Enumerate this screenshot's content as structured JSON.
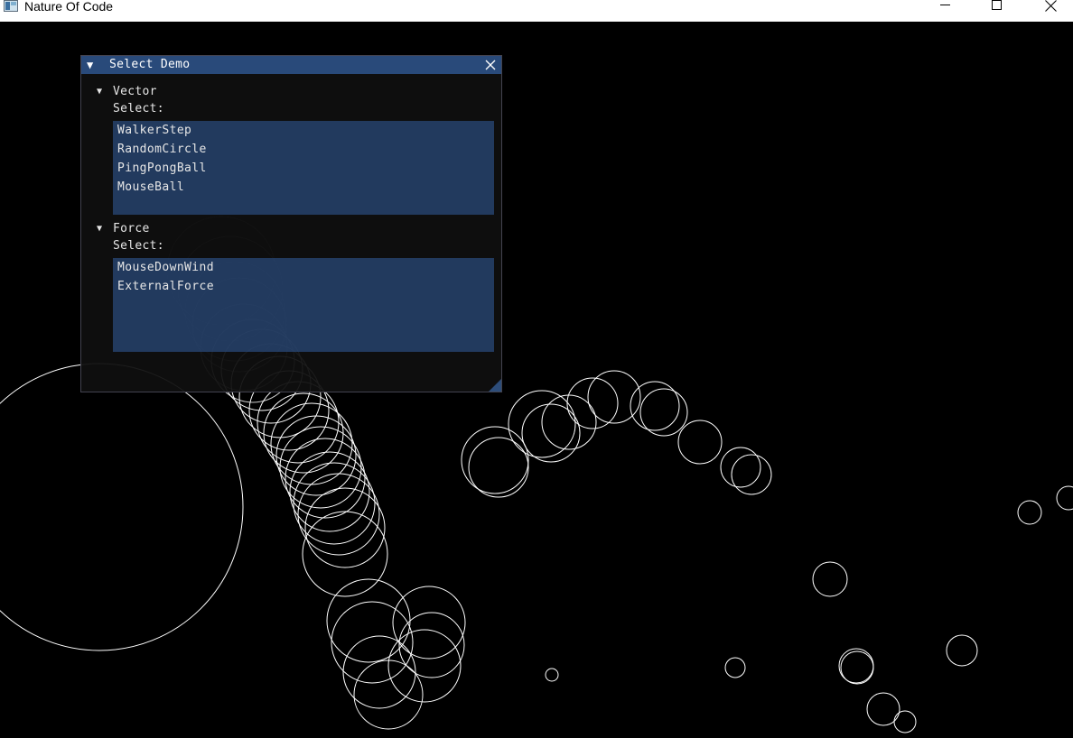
{
  "window": {
    "title": "Nature Of Code",
    "icon": "app-icon",
    "controls": {
      "minimize": "minimize-icon",
      "maximize": "maximize-icon",
      "close": "close-icon"
    }
  },
  "demo_panel": {
    "title": "Select Demo",
    "sections": [
      {
        "label": "Vector",
        "select_label": "Select:",
        "items": [
          "WalkerStep",
          "RandomCircle",
          "PingPongBall",
          "MouseBall"
        ]
      },
      {
        "label": "Force",
        "select_label": "Select:",
        "items": [
          "MouseDownWind",
          "ExternalForce"
        ]
      }
    ]
  },
  "colors": {
    "titlebar_active": "#294a7a",
    "listbox_bg": "#294a7a",
    "window_bg": "#0f0f0f",
    "canvas_bg": "#000000",
    "stroke": "#ffffff"
  }
}
